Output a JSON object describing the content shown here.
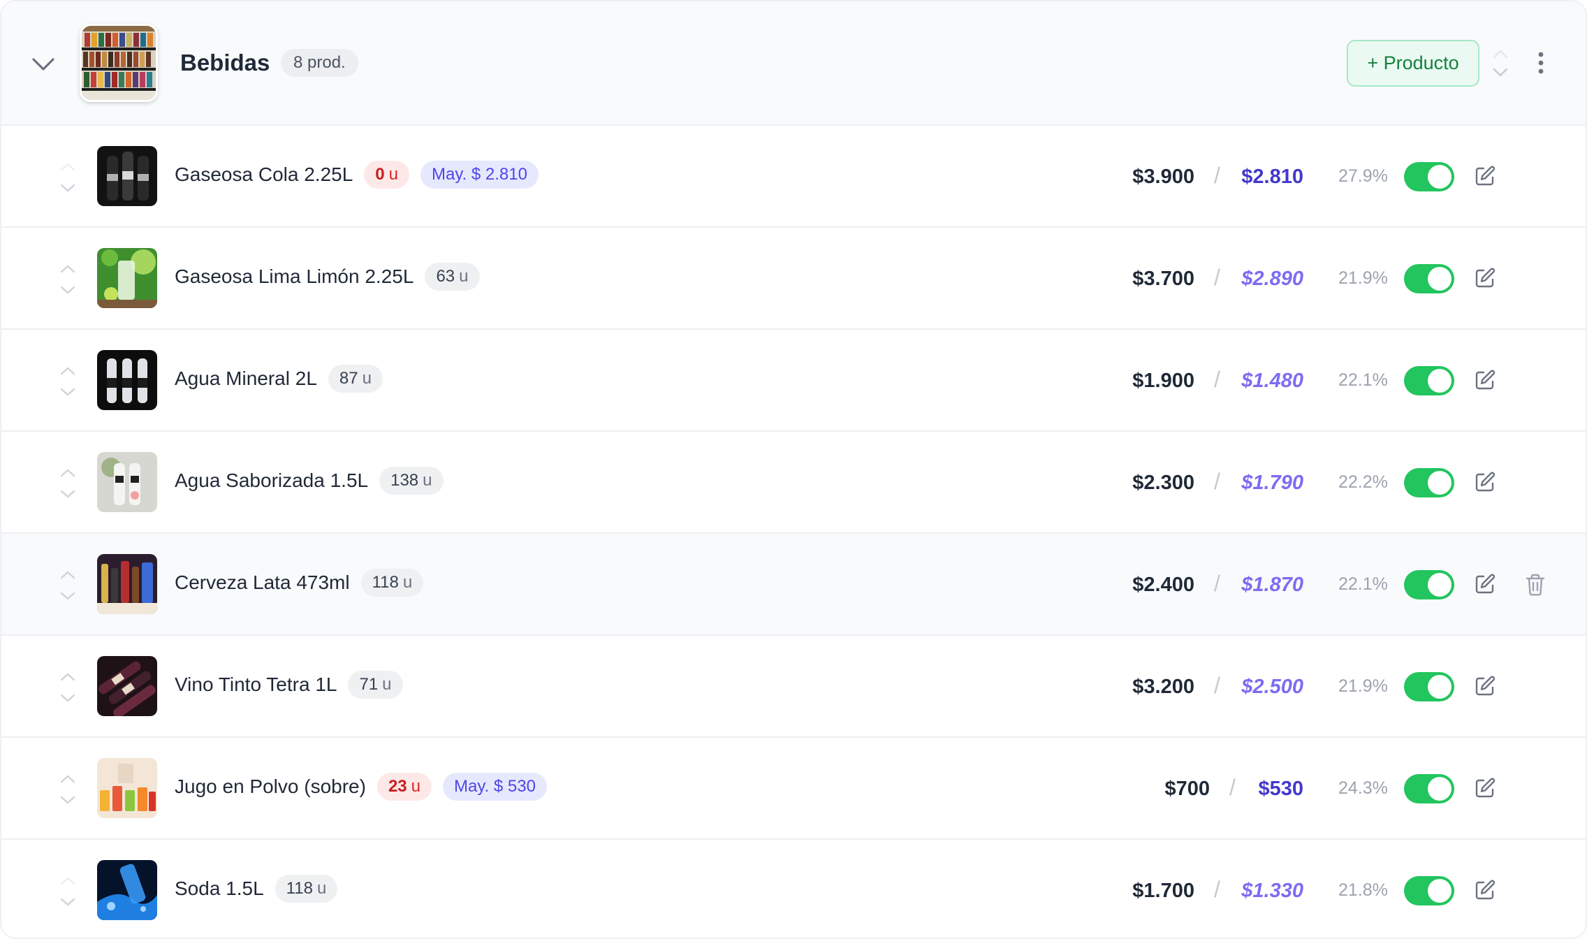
{
  "category": {
    "title": "Bebidas",
    "count": "8 prod.",
    "add_button": "+ Producto",
    "icons": {
      "collapse": "chevron-down-icon",
      "reorder": "sort-arrows-icon",
      "menu": "more-vertical-icon"
    }
  },
  "colors": {
    "accent_green": "#22c55e",
    "wholesale_indigo": "#4f46e5",
    "stock_low": "#c81e1e"
  },
  "products": [
    {
      "name": "Gaseosa Cola 2.25L",
      "stock": "0",
      "unit": "u",
      "stock_low": true,
      "wholesale": "May. $ 2.810",
      "price": "$3.900",
      "slash": "/",
      "wholesale_price": "$2.810",
      "wholesale_fixed": true,
      "margin": "27.9%",
      "active": true
    },
    {
      "name": "Gaseosa Lima Limón 2.25L",
      "stock": "63",
      "unit": "u",
      "stock_low": false,
      "wholesale": "",
      "price": "$3.700",
      "slash": "/",
      "wholesale_price": "$2.890",
      "wholesale_fixed": false,
      "margin": "21.9%",
      "active": true
    },
    {
      "name": "Agua Mineral 2L",
      "stock": "87",
      "unit": "u",
      "stock_low": false,
      "wholesale": "",
      "price": "$1.900",
      "slash": "/",
      "wholesale_price": "$1.480",
      "wholesale_fixed": false,
      "margin": "22.1%",
      "active": true
    },
    {
      "name": "Agua Saborizada 1.5L",
      "stock": "138",
      "unit": "u",
      "stock_low": false,
      "wholesale": "",
      "price": "$2.300",
      "slash": "/",
      "wholesale_price": "$1.790",
      "wholesale_fixed": false,
      "margin": "22.2%",
      "active": true
    },
    {
      "name": "Cerveza Lata 473ml",
      "stock": "118",
      "unit": "u",
      "stock_low": false,
      "wholesale": "",
      "price": "$2.400",
      "slash": "/",
      "wholesale_price": "$1.870",
      "wholesale_fixed": false,
      "margin": "22.1%",
      "active": true
    },
    {
      "name": "Vino Tinto Tetra 1L",
      "stock": "71",
      "unit": "u",
      "stock_low": false,
      "wholesale": "",
      "price": "$3.200",
      "slash": "/",
      "wholesale_price": "$2.500",
      "wholesale_fixed": false,
      "margin": "21.9%",
      "active": true
    },
    {
      "name": "Jugo en Polvo (sobre)",
      "stock": "23",
      "unit": "u",
      "stock_low": true,
      "wholesale": "May. $ 530",
      "price": "$700",
      "slash": "/",
      "wholesale_price": "$530",
      "wholesale_fixed": true,
      "margin": "24.3%",
      "active": true
    },
    {
      "name": "Soda 1.5L",
      "stock": "118",
      "unit": "u",
      "stock_low": false,
      "wholesale": "",
      "price": "$1.700",
      "slash": "/",
      "wholesale_price": "$1.330",
      "wholesale_fixed": false,
      "margin": "21.8%",
      "active": true
    }
  ]
}
